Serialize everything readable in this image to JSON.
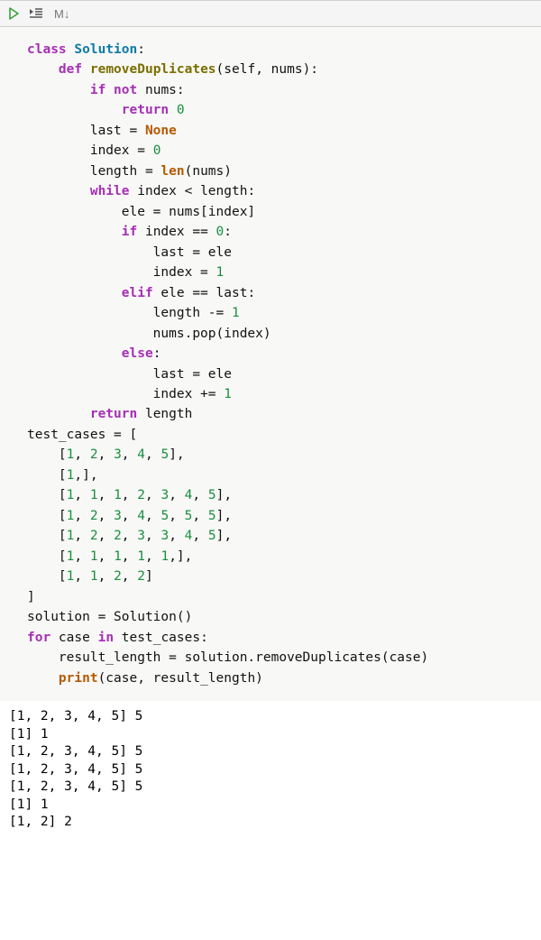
{
  "toolbar": {
    "run_icon": "run-icon",
    "run_cursor_icon": "run-cursor-icon",
    "markdown_label": "M↓"
  },
  "code": {
    "lines": [
      [
        [
          "kw",
          "class"
        ],
        [
          "txt",
          " "
        ],
        [
          "cls",
          "Solution"
        ],
        [
          "txt",
          ":"
        ]
      ],
      [
        [
          "txt",
          "    "
        ],
        [
          "kw",
          "def"
        ],
        [
          "txt",
          " "
        ],
        [
          "fn",
          "removeDuplicates"
        ],
        [
          "txt",
          "(self, nums):"
        ]
      ],
      [
        [
          "txt",
          "        "
        ],
        [
          "kw",
          "if"
        ],
        [
          "txt",
          " "
        ],
        [
          "kw",
          "not"
        ],
        [
          "txt",
          " nums:"
        ]
      ],
      [
        [
          "txt",
          "            "
        ],
        [
          "kw",
          "return"
        ],
        [
          "txt",
          " "
        ],
        [
          "num",
          "0"
        ]
      ],
      [
        [
          "txt",
          "        last = "
        ],
        [
          "bi",
          "None"
        ]
      ],
      [
        [
          "txt",
          "        index = "
        ],
        [
          "num",
          "0"
        ]
      ],
      [
        [
          "txt",
          "        length = "
        ],
        [
          "bi",
          "len"
        ],
        [
          "txt",
          "(nums)"
        ]
      ],
      [
        [
          "txt",
          "        "
        ],
        [
          "kw",
          "while"
        ],
        [
          "txt",
          " index < length:"
        ]
      ],
      [
        [
          "txt",
          "            ele = nums[index]"
        ]
      ],
      [
        [
          "txt",
          "            "
        ],
        [
          "kw",
          "if"
        ],
        [
          "txt",
          " index == "
        ],
        [
          "num",
          "0"
        ],
        [
          "txt",
          ":"
        ]
      ],
      [
        [
          "txt",
          "                last = ele"
        ]
      ],
      [
        [
          "txt",
          "                index = "
        ],
        [
          "num",
          "1"
        ]
      ],
      [
        [
          "txt",
          "            "
        ],
        [
          "kw",
          "elif"
        ],
        [
          "txt",
          " ele == last:"
        ]
      ],
      [
        [
          "txt",
          "                length -= "
        ],
        [
          "num",
          "1"
        ]
      ],
      [
        [
          "txt",
          "                nums.pop(index)"
        ]
      ],
      [
        [
          "txt",
          "            "
        ],
        [
          "kw",
          "else"
        ],
        [
          "txt",
          ":"
        ]
      ],
      [
        [
          "txt",
          "                last = ele"
        ]
      ],
      [
        [
          "txt",
          "                index += "
        ],
        [
          "num",
          "1"
        ]
      ],
      [
        [
          "txt",
          "        "
        ],
        [
          "kw",
          "return"
        ],
        [
          "txt",
          " length"
        ]
      ],
      [
        [
          "txt",
          "test_cases = ["
        ]
      ],
      [
        [
          "txt",
          "    ["
        ],
        [
          "num",
          "1"
        ],
        [
          "txt",
          ", "
        ],
        [
          "num",
          "2"
        ],
        [
          "txt",
          ", "
        ],
        [
          "num",
          "3"
        ],
        [
          "txt",
          ", "
        ],
        [
          "num",
          "4"
        ],
        [
          "txt",
          ", "
        ],
        [
          "num",
          "5"
        ],
        [
          "txt",
          "],"
        ]
      ],
      [
        [
          "txt",
          "    ["
        ],
        [
          "num",
          "1"
        ],
        [
          "txt",
          ",],"
        ]
      ],
      [
        [
          "txt",
          "    ["
        ],
        [
          "num",
          "1"
        ],
        [
          "txt",
          ", "
        ],
        [
          "num",
          "1"
        ],
        [
          "txt",
          ", "
        ],
        [
          "num",
          "1"
        ],
        [
          "txt",
          ", "
        ],
        [
          "num",
          "2"
        ],
        [
          "txt",
          ", "
        ],
        [
          "num",
          "3"
        ],
        [
          "txt",
          ", "
        ],
        [
          "num",
          "4"
        ],
        [
          "txt",
          ", "
        ],
        [
          "num",
          "5"
        ],
        [
          "txt",
          "],"
        ]
      ],
      [
        [
          "txt",
          "    ["
        ],
        [
          "num",
          "1"
        ],
        [
          "txt",
          ", "
        ],
        [
          "num",
          "2"
        ],
        [
          "txt",
          ", "
        ],
        [
          "num",
          "3"
        ],
        [
          "txt",
          ", "
        ],
        [
          "num",
          "4"
        ],
        [
          "txt",
          ", "
        ],
        [
          "num",
          "5"
        ],
        [
          "txt",
          ", "
        ],
        [
          "num",
          "5"
        ],
        [
          "txt",
          ", "
        ],
        [
          "num",
          "5"
        ],
        [
          "txt",
          "],"
        ]
      ],
      [
        [
          "txt",
          "    ["
        ],
        [
          "num",
          "1"
        ],
        [
          "txt",
          ", "
        ],
        [
          "num",
          "2"
        ],
        [
          "txt",
          ", "
        ],
        [
          "num",
          "2"
        ],
        [
          "txt",
          ", "
        ],
        [
          "num",
          "3"
        ],
        [
          "txt",
          ", "
        ],
        [
          "num",
          "3"
        ],
        [
          "txt",
          ", "
        ],
        [
          "num",
          "4"
        ],
        [
          "txt",
          ", "
        ],
        [
          "num",
          "5"
        ],
        [
          "txt",
          "],"
        ]
      ],
      [
        [
          "txt",
          "    ["
        ],
        [
          "num",
          "1"
        ],
        [
          "txt",
          ", "
        ],
        [
          "num",
          "1"
        ],
        [
          "txt",
          ", "
        ],
        [
          "num",
          "1"
        ],
        [
          "txt",
          ", "
        ],
        [
          "num",
          "1"
        ],
        [
          "txt",
          ", "
        ],
        [
          "num",
          "1"
        ],
        [
          "txt",
          ",],"
        ]
      ],
      [
        [
          "txt",
          "    ["
        ],
        [
          "num",
          "1"
        ],
        [
          "txt",
          ", "
        ],
        [
          "num",
          "1"
        ],
        [
          "txt",
          ", "
        ],
        [
          "num",
          "2"
        ],
        [
          "txt",
          ", "
        ],
        [
          "num",
          "2"
        ],
        [
          "txt",
          "]"
        ]
      ],
      [
        [
          "txt",
          "]"
        ]
      ],
      [
        [
          "txt",
          "solution = Solution()"
        ]
      ],
      [
        [
          "kw",
          "for"
        ],
        [
          "txt",
          " case "
        ],
        [
          "kw",
          "in"
        ],
        [
          "txt",
          " test_cases:"
        ]
      ],
      [
        [
          "txt",
          "    result_length = solution.removeDuplicates(case)"
        ]
      ],
      [
        [
          "txt",
          "    "
        ],
        [
          "bi",
          "print"
        ],
        [
          "txt",
          "(case, result_length)"
        ]
      ]
    ]
  },
  "output": {
    "lines": [
      "[1, 2, 3, 4, 5] 5",
      "[1] 1",
      "[1, 2, 3, 4, 5] 5",
      "[1, 2, 3, 4, 5] 5",
      "[1, 2, 3, 4, 5] 5",
      "[1] 1",
      "[1, 2] 2"
    ]
  }
}
